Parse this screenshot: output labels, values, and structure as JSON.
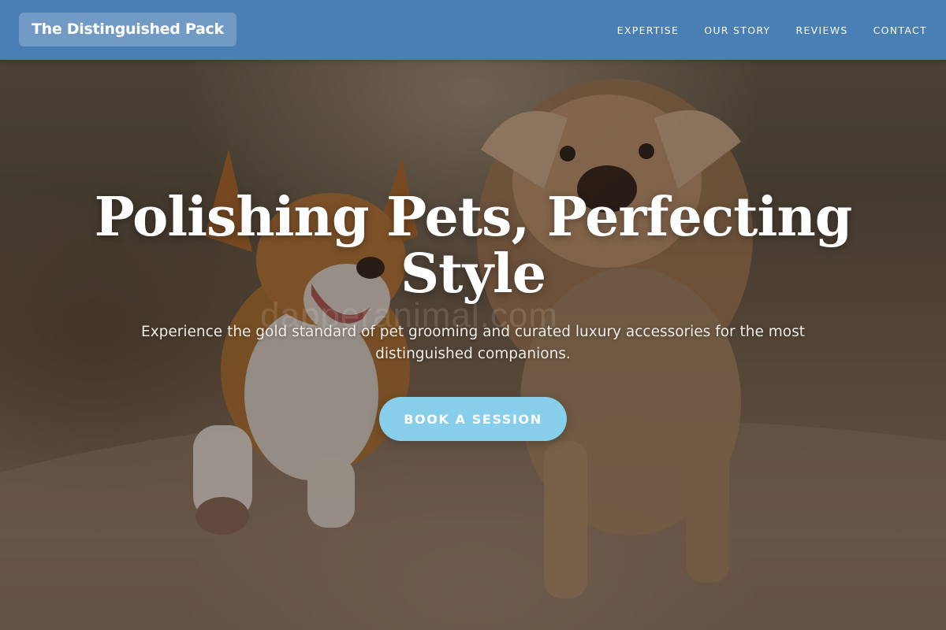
{
  "header": {
    "brand": "The Distinguished Pack",
    "nav": [
      {
        "label": "EXPERTISE"
      },
      {
        "label": "OUR STORY"
      },
      {
        "label": "REVIEWS"
      },
      {
        "label": "CONTACT"
      }
    ],
    "background_color": "#4a7fb5"
  },
  "hero": {
    "title": "Polishing Pets, Perfecting Style",
    "subtitle": "Experience the gold standard of pet grooming and curated luxury accessories for the most distinguished companions.",
    "cta_label": "BOOK A SESSION",
    "cta_color": "#87ceeb",
    "watermark": "dapperanimal.com",
    "background_image": "two-dogs-running-photo"
  }
}
